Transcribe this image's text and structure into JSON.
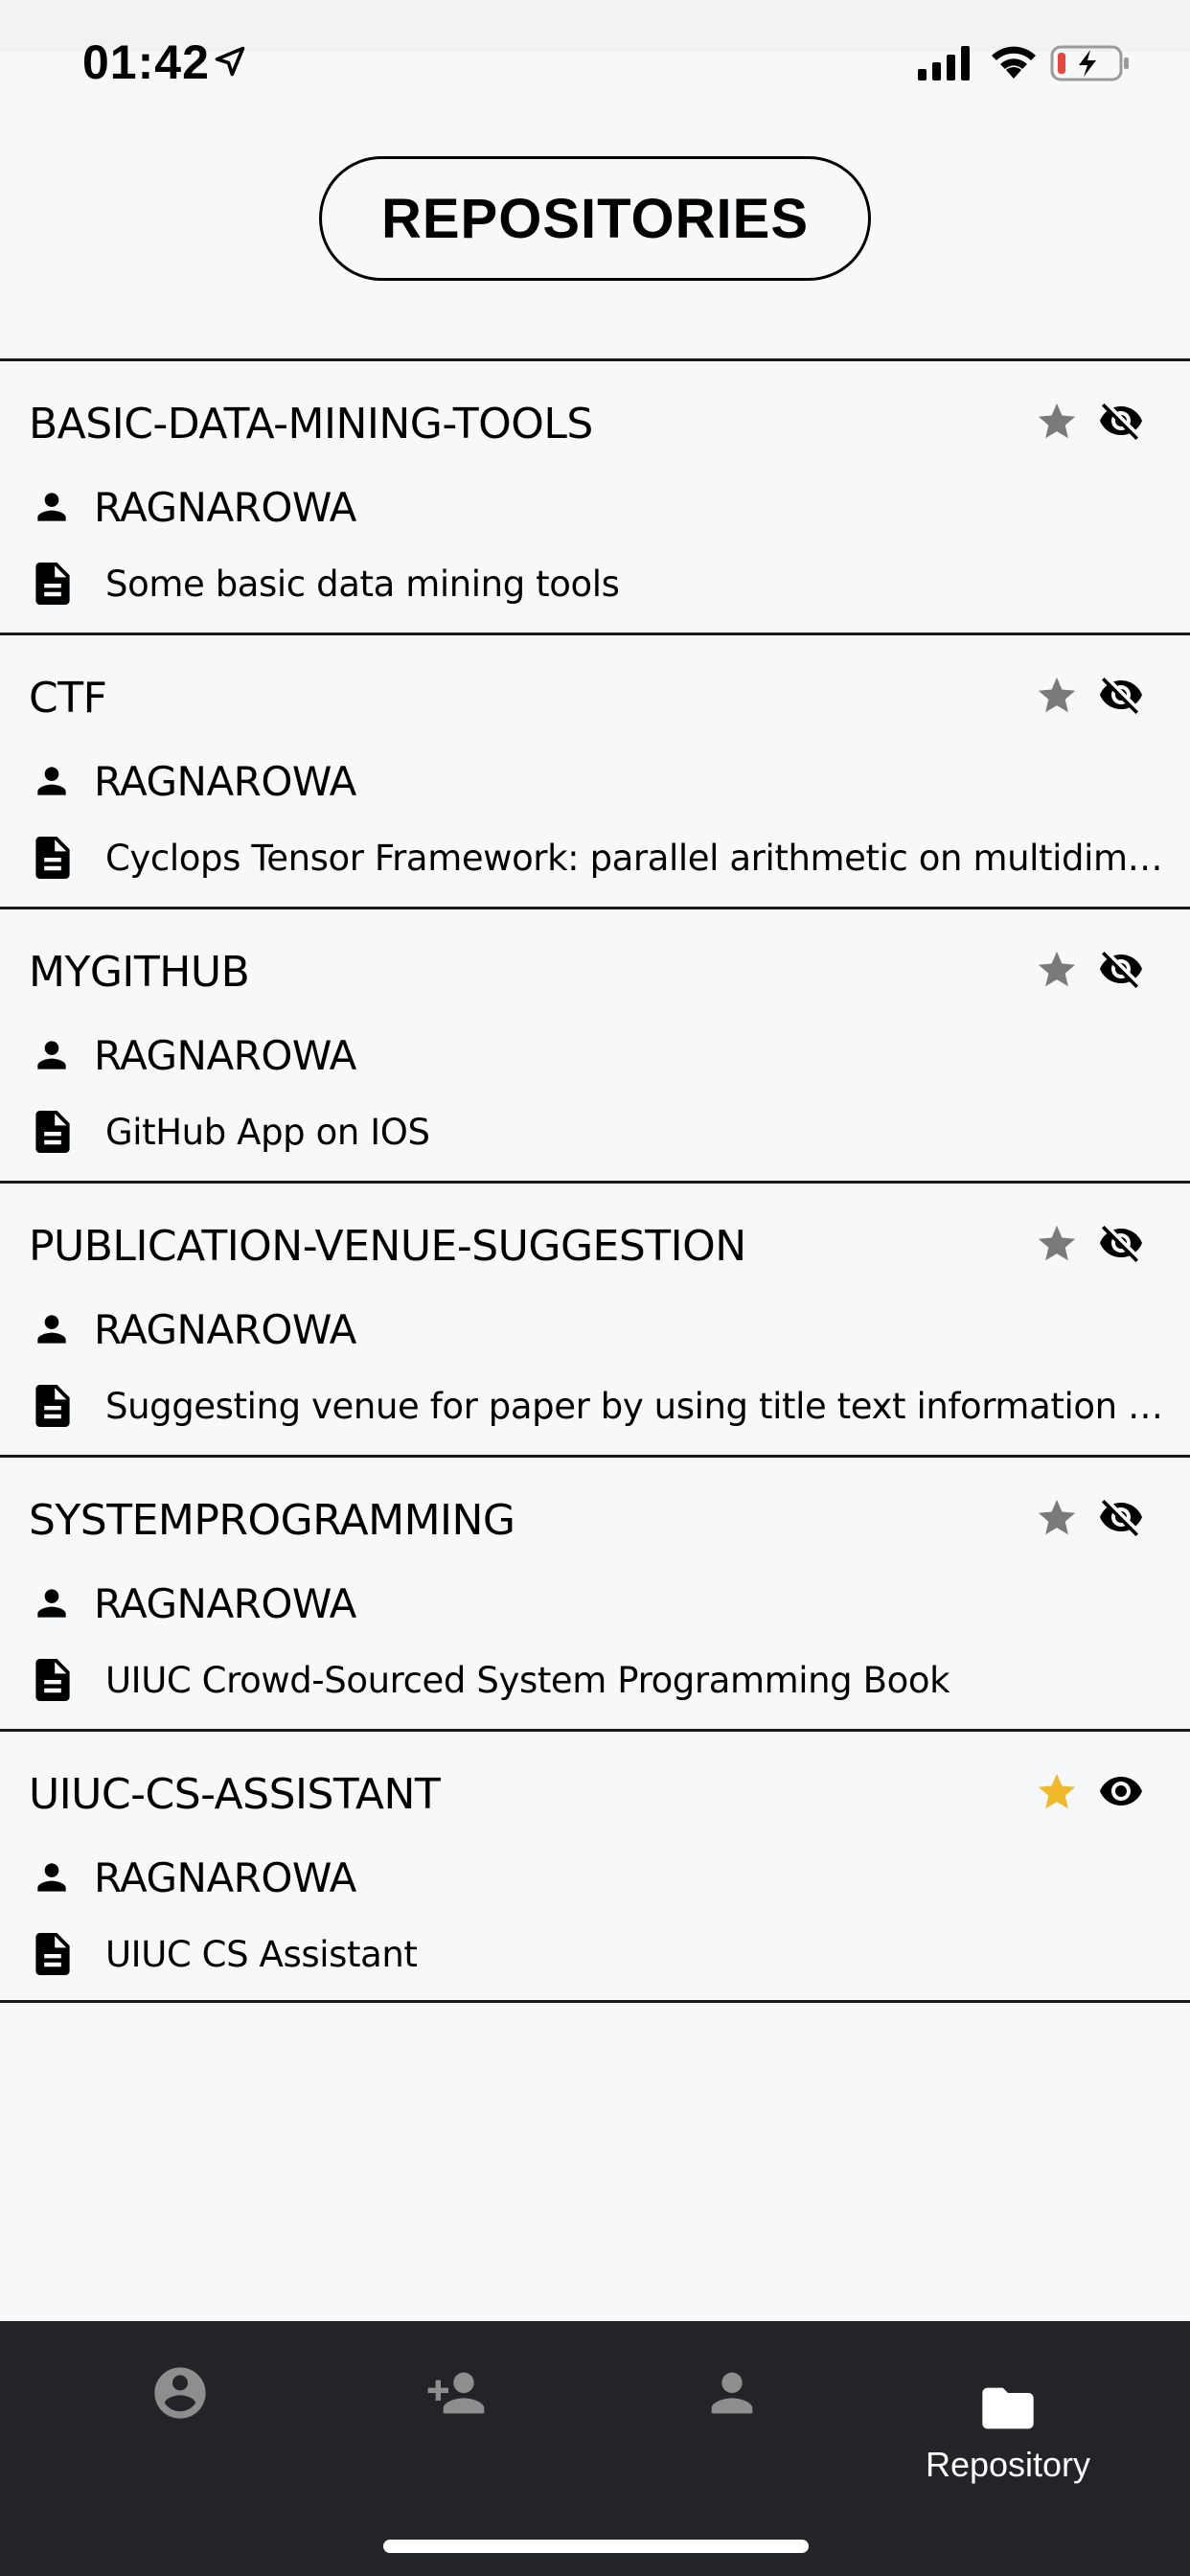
{
  "status_bar": {
    "time": "01:42"
  },
  "header": {
    "title": "REPOSITORIES"
  },
  "colors": {
    "star_active": "#f0b92b",
    "star_inactive": "#7a7a7a",
    "tab_bar": "#222427",
    "tab_inactive": "#8e8e8e",
    "tab_active": "#ffffff"
  },
  "repositories": [
    {
      "name": "BASIC-DATA-MINING-TOOLS",
      "owner": "RAGNAROWA",
      "description": "Some basic data mining tools",
      "starred": false,
      "watching": false
    },
    {
      "name": "CTF",
      "owner": "RAGNAROWA",
      "description": "Cyclops Tensor Framework: parallel arithmetic on multidimens...",
      "starred": false,
      "watching": false
    },
    {
      "name": "MYGITHUB",
      "owner": "RAGNAROWA",
      "description": "GitHub App on IOS",
      "starred": false,
      "watching": false
    },
    {
      "name": "PUBLICATION-VENUE-SUGGESTION",
      "owner": "RAGNAROWA",
      "description": "Suggesting venue for paper by using title text information a...",
      "starred": false,
      "watching": false
    },
    {
      "name": "SYSTEMPROGRAMMING",
      "owner": "RAGNAROWA",
      "description": "UIUC Crowd-Sourced System Programming Book",
      "starred": false,
      "watching": false
    },
    {
      "name": "UIUC-CS-ASSISTANT",
      "owner": "RAGNAROWA",
      "description": "UIUC CS Assistant",
      "starred": true,
      "watching": true
    }
  ],
  "tab_bar": {
    "tabs": [
      {
        "icon": "account-circle-icon",
        "label": "",
        "active": false
      },
      {
        "icon": "person-add-icon",
        "label": "",
        "active": false
      },
      {
        "icon": "person-icon",
        "label": "",
        "active": false
      },
      {
        "icon": "folder-icon",
        "label": "Repository",
        "active": true
      }
    ]
  }
}
